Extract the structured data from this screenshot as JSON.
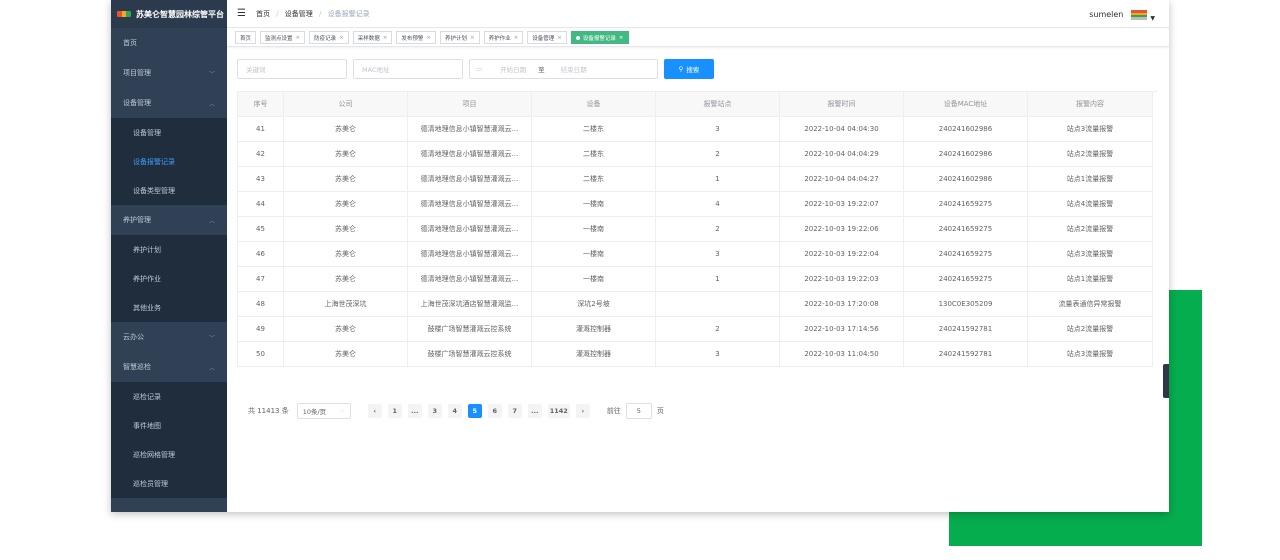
{
  "app": {
    "title": "苏美仑智慧园林综管平台"
  },
  "header": {
    "breadcrumb": [
      "首页",
      "设备管理",
      "设备报警记录"
    ],
    "user": "sumelen"
  },
  "sidebar": {
    "items": [
      {
        "label": "首页",
        "type": "item"
      },
      {
        "label": "项目管理",
        "type": "group",
        "chevron": "chevron-down"
      },
      {
        "label": "设备管理",
        "type": "group",
        "chevron": "chevron-up"
      },
      {
        "label": "设备管理",
        "type": "sub"
      },
      {
        "label": "设备报警记录",
        "type": "sub",
        "active": true
      },
      {
        "label": "设备类型管理",
        "type": "sub"
      },
      {
        "label": "养护管理",
        "type": "group",
        "chevron": "chevron-up"
      },
      {
        "label": "养护计划",
        "type": "sub"
      },
      {
        "label": "养护作业",
        "type": "sub"
      },
      {
        "label": "其他业务",
        "type": "sub"
      },
      {
        "label": "云办公",
        "type": "group",
        "chevron": "chevron-down"
      },
      {
        "label": "智慧巡检",
        "type": "group",
        "chevron": "chevron-up"
      },
      {
        "label": "巡检记录",
        "type": "sub"
      },
      {
        "label": "事件地图",
        "type": "sub"
      },
      {
        "label": "巡检网格管理",
        "type": "sub"
      },
      {
        "label": "巡检员管理",
        "type": "sub"
      }
    ]
  },
  "tags": [
    {
      "label": "首页",
      "closable": false
    },
    {
      "label": "监测点设置",
      "closable": true
    },
    {
      "label": "防疫记录",
      "closable": true
    },
    {
      "label": "采样数据",
      "closable": true
    },
    {
      "label": "发布预警",
      "closable": true
    },
    {
      "label": "养护计划",
      "closable": true
    },
    {
      "label": "养护作业",
      "closable": true
    },
    {
      "label": "设备管理",
      "closable": true
    },
    {
      "label": "设备报警记录",
      "closable": true,
      "active": true
    }
  ],
  "filters": {
    "keyword_placeholder": "关键词",
    "mac_placeholder": "MAC地址",
    "start_placeholder": "开始日期",
    "range_separator": "至",
    "end_placeholder": "结束日期",
    "search_label": "搜索"
  },
  "table": {
    "columns": [
      "序号",
      "公司",
      "项目",
      "设备",
      "报警站点",
      "报警时间",
      "设备MAC地址",
      "报警内容"
    ],
    "rows": [
      [
        "41",
        "苏美仑",
        "德清地理信息小镇智慧灌溉云...",
        "二楼东",
        "3",
        "2022-10-04 04:04:30",
        "240241602986",
        "站点3流量报警"
      ],
      [
        "42",
        "苏美仑",
        "德清地理信息小镇智慧灌溉云...",
        "二楼东",
        "2",
        "2022-10-04 04:04:29",
        "240241602986",
        "站点2流量报警"
      ],
      [
        "43",
        "苏美仑",
        "德清地理信息小镇智慧灌溉云...",
        "二楼东",
        "1",
        "2022-10-04 04:04:27",
        "240241602986",
        "站点1流量报警"
      ],
      [
        "44",
        "苏美仑",
        "德清地理信息小镇智慧灌溉云...",
        "一楼南",
        "4",
        "2022-10-03 19:22:07",
        "240241659275",
        "站点4流量报警"
      ],
      [
        "45",
        "苏美仑",
        "德清地理信息小镇智慧灌溉云...",
        "一楼南",
        "2",
        "2022-10-03 19:22:06",
        "240241659275",
        "站点2流量报警"
      ],
      [
        "46",
        "苏美仑",
        "德清地理信息小镇智慧灌溉云...",
        "一楼南",
        "3",
        "2022-10-03 19:22:04",
        "240241659275",
        "站点3流量报警"
      ],
      [
        "47",
        "苏美仑",
        "德清地理信息小镇智慧灌溉云...",
        "一楼南",
        "1",
        "2022-10-03 19:22:03",
        "240241659275",
        "站点1流量报警"
      ],
      [
        "48",
        "上海世茂深坑",
        "上海世茂深坑酒店智慧灌溉监...",
        "深坑2号坡",
        "",
        "2022-10-03 17:20:08",
        "130C0E305209",
        "流量表通信异常报警"
      ],
      [
        "49",
        "苏美仑",
        "鼓楼广场智慧灌溉云控系统",
        "灌溉控制器",
        "2",
        "2022-10-03 17:14:56",
        "240241592781",
        "站点2流量报警"
      ],
      [
        "50",
        "苏美仑",
        "鼓楼广场智慧灌溉云控系统",
        "灌溉控制器",
        "3",
        "2022-10-03 11:04:50",
        "240241592781",
        "站点3流量报警"
      ]
    ]
  },
  "pagination": {
    "total_text": "共 11413 条",
    "page_size": "10条/页",
    "pages": [
      "1",
      "...",
      "3",
      "4",
      "5",
      "6",
      "7",
      "...",
      "1142"
    ],
    "current": "5",
    "goto_label": "前往",
    "goto_value": "5",
    "goto_suffix": "页"
  },
  "icons": {
    "prev": "chevron-left-icon",
    "next": "chevron-right-icon",
    "search": "search-icon",
    "calendar": "calendar-icon",
    "menu": "hamburger-icon"
  },
  "colors": {
    "primary": "#1890ff",
    "active_tag": "#42b983",
    "sidebar_bg": "#304156",
    "deco_green": "#06ad4e"
  }
}
